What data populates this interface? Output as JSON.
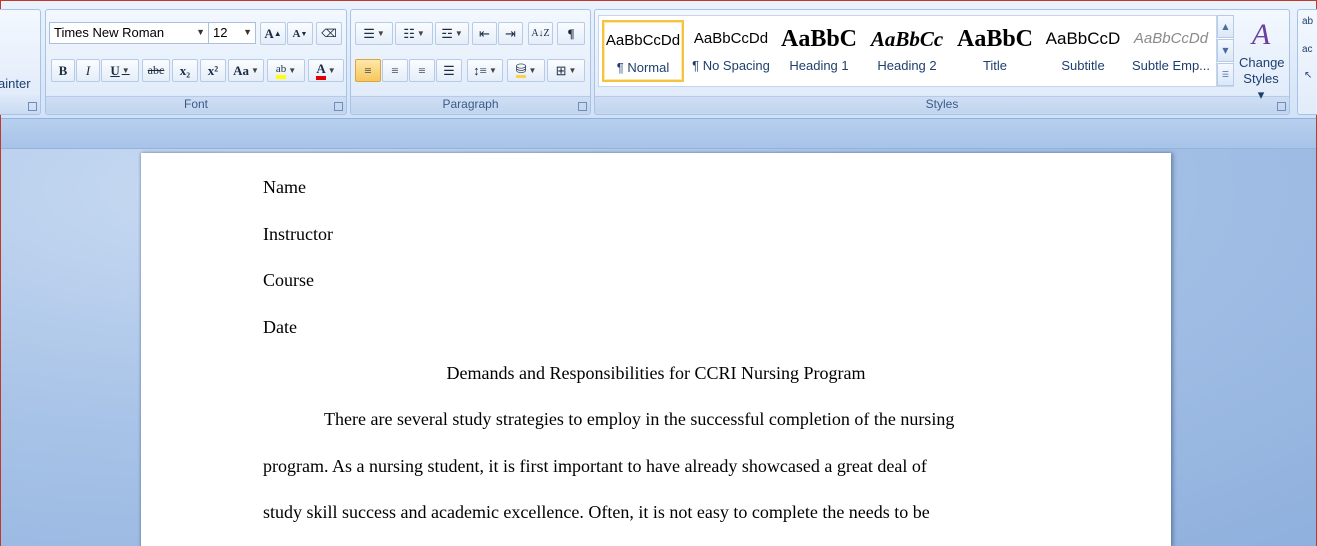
{
  "clipboard": {
    "painter_fragment": "ainter"
  },
  "font": {
    "group_label": "Font",
    "font_name": "Times New Roman",
    "font_size": "12",
    "grow_label": "A",
    "shrink_label": "A",
    "clear_label": "",
    "bold_label": "B",
    "italic_label": "I",
    "underline_label": "U",
    "strike_label": "abc",
    "subscript_label": "x₂",
    "superscript_label": "x²",
    "case_label": "Aa",
    "highlight_label": "ab",
    "color_label": "A",
    "highlight_color": "#ffff00",
    "font_color": "#e00000"
  },
  "paragraph": {
    "group_label": "Paragraph",
    "pilcrow_label": "¶"
  },
  "styles": {
    "group_label": "Styles",
    "items": [
      {
        "sample": "AaBbCcDd",
        "label": "¶ Normal"
      },
      {
        "sample": "AaBbCcDd",
        "label": "¶ No Spacing"
      },
      {
        "sample": "AaBbC",
        "label": "Heading 1"
      },
      {
        "sample": "AaBbCc",
        "label": "Heading 2"
      },
      {
        "sample": "AaBbC",
        "label": "Title"
      },
      {
        "sample": "AaBbCcD",
        "label": "Subtitle"
      },
      {
        "sample": "AaBbCcDd",
        "label": "Subtle Emp..."
      }
    ],
    "change_styles_line1": "Change",
    "change_styles_line2": "Styles ▾"
  },
  "document": {
    "lines": [
      "Name",
      "Instructor",
      "Course",
      "Date"
    ],
    "title": "Demands and Responsibilities for CCRI Nursing Program",
    "body": [
      "There are several study strategies to employ in the successful completion of the nursing",
      "program. As a nursing student, it is first important to have already showcased a great deal of",
      "study skill success and academic excellence. Often, it is not easy to complete the needs to be"
    ]
  }
}
